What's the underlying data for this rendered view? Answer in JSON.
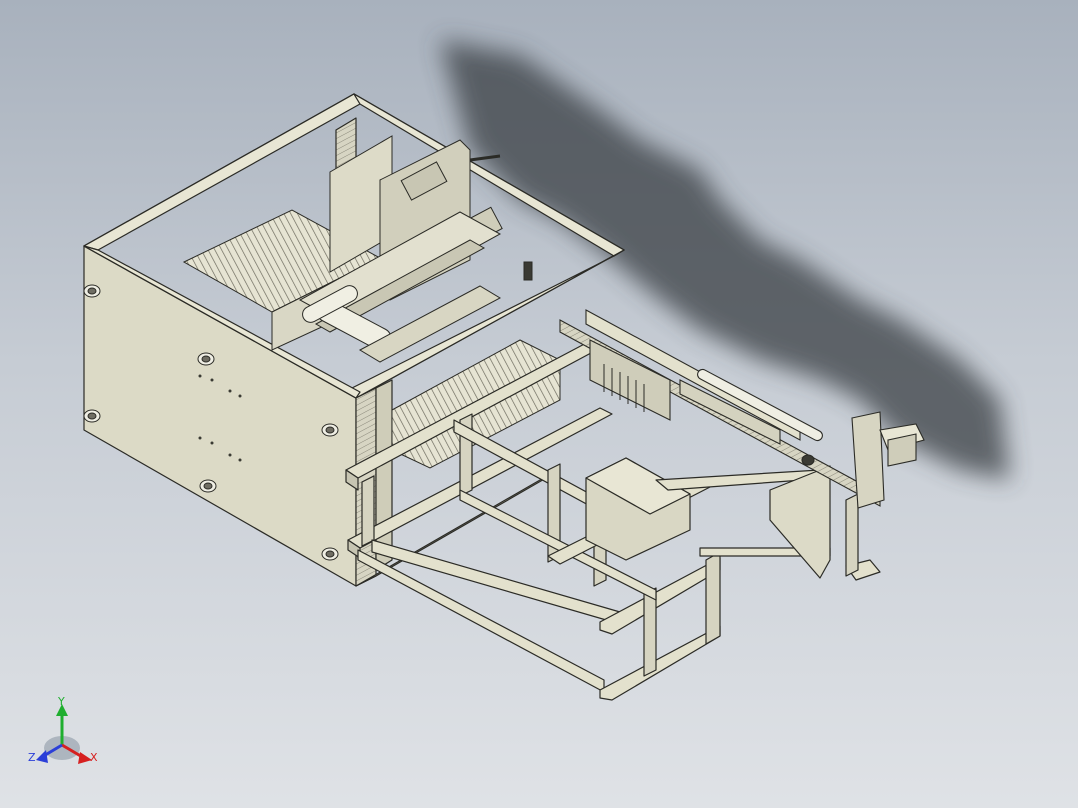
{
  "viewport": {
    "background_top": "#a8b1bd",
    "background_bottom": "#dfe2e6",
    "model_color": "#e3e1cd",
    "edge_color": "#2b2b26",
    "shadow_color": "#3a3f45"
  },
  "triad": {
    "y_label": "Y",
    "z_label": "Z",
    "x_label": "X",
    "y_color": "#1fae2f",
    "z_color": "#2b3fd8",
    "x_color": "#d62020"
  }
}
